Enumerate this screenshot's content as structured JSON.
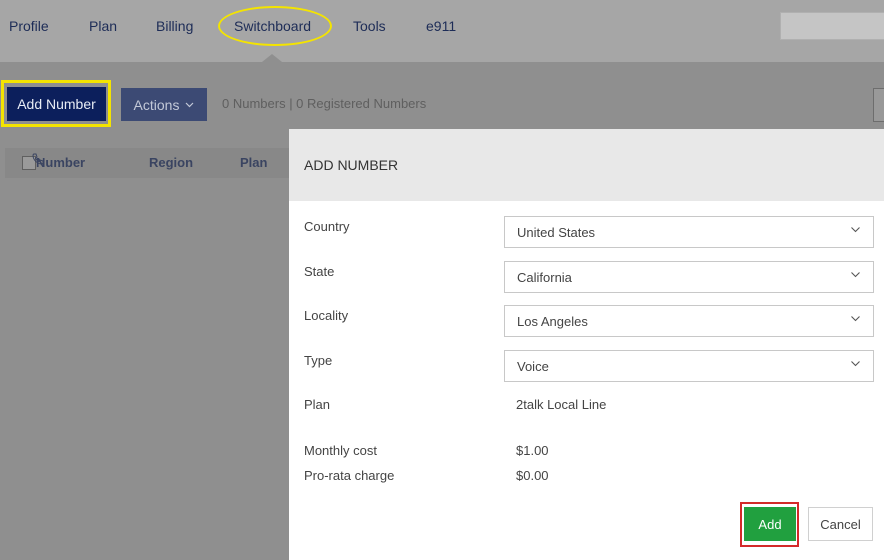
{
  "nav": {
    "items": [
      "Profile",
      "Plan",
      "Billing",
      "Switchboard",
      "Tools",
      "e911"
    ],
    "active": "Switchboard"
  },
  "toolbar": {
    "add_number_label": "Add Number",
    "actions_label": "Actions",
    "counts": "0 Numbers | 0 Registered Numbers"
  },
  "table": {
    "columns": [
      "Number",
      "Region",
      "Plan"
    ]
  },
  "modal": {
    "title": "ADD NUMBER",
    "fields": {
      "country": {
        "label": "Country",
        "value": "United States"
      },
      "state": {
        "label": "State",
        "value": "California"
      },
      "locality": {
        "label": "Locality",
        "value": "Los Angeles"
      },
      "type": {
        "label": "Type",
        "value": "Voice"
      },
      "plan": {
        "label": "Plan",
        "value": "2talk Local Line"
      },
      "monthly_cost": {
        "label": "Monthly cost",
        "value": "$1.00"
      },
      "prorata": {
        "label": "Pro-rata charge",
        "value": "$0.00"
      }
    },
    "add_label": "Add",
    "cancel_label": "Cancel"
  },
  "colors": {
    "primary": "#0c1f5c",
    "add_green": "#21a03f",
    "highlight_yellow": "#f4e400",
    "highlight_red": "#d42a2a"
  }
}
